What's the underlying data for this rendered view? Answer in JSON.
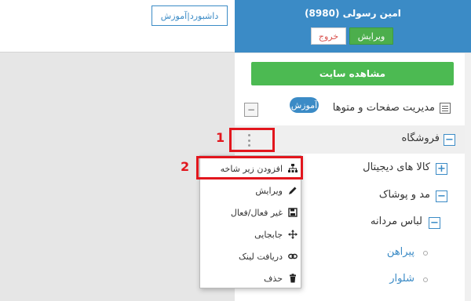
{
  "header": {
    "user_name": "امین رسولی (8980)",
    "edit_label": "ویرایش",
    "logout_label": "خروج",
    "dashboard_link": "داشبورد|آموزش"
  },
  "sidebar": {
    "view_site_label": "مشاهده سایت",
    "pages_label": "مدیریت صفحات و متوها",
    "learn_badge": "آموزش",
    "tree": {
      "shop": "فروشگاه",
      "digital": "کالا های دیجیتال",
      "fashion": "مد و پوشاک",
      "men_clothing": "لباس مردانه",
      "shirt": "پیراهن",
      "pants": "شلوار"
    },
    "collapse_sign": "−",
    "expand_sign": "+"
  },
  "context_menu": {
    "items": [
      {
        "label": "افزودن زیر شاخه",
        "icon": "sitemap-icon"
      },
      {
        "label": "ویرایش",
        "icon": "pencil-icon"
      },
      {
        "label": "غیر فعال/فعال",
        "icon": "save-icon"
      },
      {
        "label": "جابجایی",
        "icon": "move-icon"
      },
      {
        "label": "دریافت لینک",
        "icon": "link-icon"
      },
      {
        "label": "حذف",
        "icon": "trash-icon"
      }
    ]
  },
  "annotations": {
    "step_1": "1",
    "step_2": "2"
  },
  "colors": {
    "header_blue": "#3b8bc6",
    "green": "#4cba52",
    "highlight_red": "#e2161d"
  }
}
